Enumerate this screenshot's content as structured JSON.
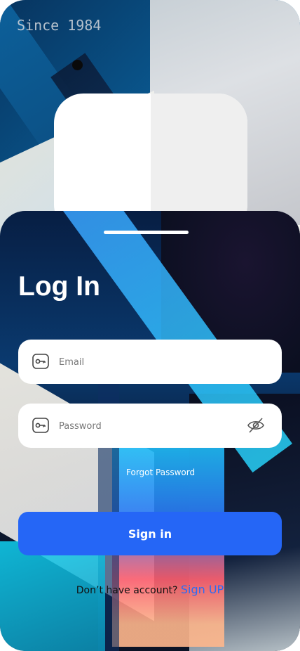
{
  "brand": {
    "text": "Since 1984"
  },
  "login": {
    "title": "Log In",
    "email_placeholder": "Email",
    "password_placeholder": "Password",
    "forgot_password": "Forgot Password",
    "sign_in": "Sign in",
    "no_account": "Don’t have account?",
    "sign_up": "Sign UP"
  },
  "colors": {
    "primary_button": "#2566f6",
    "link": "#2e6bf2"
  },
  "icons": {
    "email_field": "key-icon",
    "password_field": "key-icon",
    "password_toggle": "eye-off-icon"
  }
}
